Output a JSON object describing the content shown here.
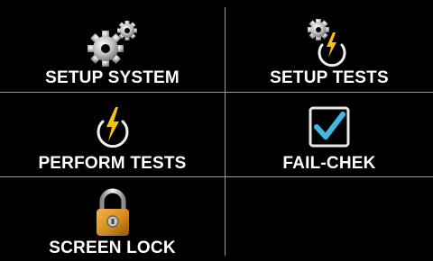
{
  "menu": {
    "tiles": [
      {
        "label": "SETUP SYSTEM",
        "icon": "gears-icon"
      },
      {
        "label": "SETUP TESTS",
        "icon": "gear-bolt-icon"
      },
      {
        "label": "PERFORM TESTS",
        "icon": "power-bolt-icon"
      },
      {
        "label": "FAIL-CHEK",
        "icon": "checkbox-icon"
      },
      {
        "label": "SCREEN LOCK",
        "icon": "padlock-icon"
      },
      {
        "label": "",
        "icon": ""
      }
    ]
  },
  "colors": {
    "background": "#000000",
    "divider": "#9a9a9a",
    "text": "#ffffff",
    "bolt": "#f2c40c",
    "check": "#40b8e0",
    "lock": "#d48b1c"
  }
}
